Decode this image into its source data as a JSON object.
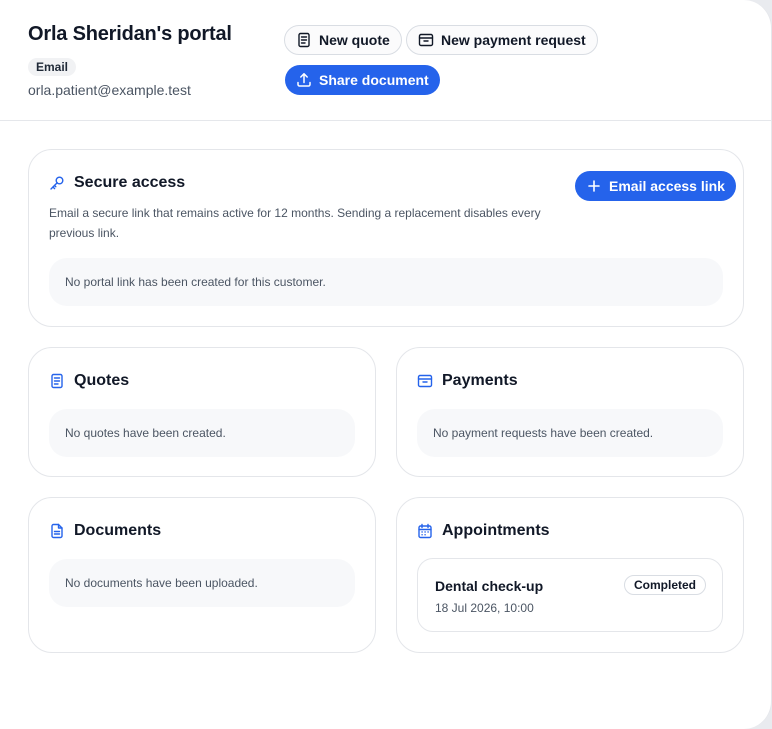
{
  "header": {
    "title": "Orla Sheridan's portal",
    "badge": "Email",
    "email": "orla.patient@example.test",
    "actions": {
      "new_quote": "New quote",
      "new_payment_request": "New payment request",
      "share_document": "Share document"
    }
  },
  "secure_access": {
    "title": "Secure access",
    "description": "Email a secure link that remains active for 12 months. Sending a replacement disables every previous link.",
    "button": "Email access link",
    "empty": "No portal link has been created for this customer."
  },
  "quotes": {
    "title": "Quotes",
    "empty": "No quotes have been created."
  },
  "payments": {
    "title": "Payments",
    "empty": "No payment requests have been created."
  },
  "documents": {
    "title": "Documents",
    "empty": "No documents have been uploaded."
  },
  "appointments": {
    "title": "Appointments",
    "items": [
      {
        "name": "Dental check-up",
        "datetime": "18 Jul 2026, 10:00",
        "status": "Completed"
      }
    ]
  },
  "colors": {
    "accent": "#2563eb",
    "card_border": "#e4e6ea",
    "empty_bg": "#f7f8fa"
  },
  "icons": {
    "new_quote": "document-lines-icon",
    "new_payment_request": "payment-box-icon",
    "share_document": "upload-icon",
    "secure_access": "key-icon",
    "email_access_link": "plus-icon",
    "quotes": "document-lines-icon",
    "payments": "payment-box-icon",
    "documents": "file-icon",
    "appointments": "calendar-icon"
  }
}
